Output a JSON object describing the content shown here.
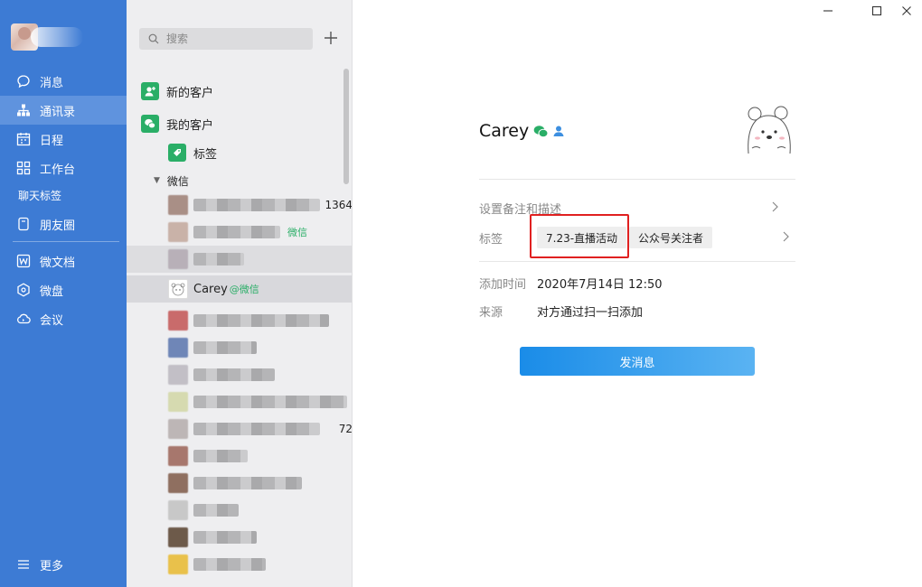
{
  "nav": {
    "items": [
      {
        "label": "消息",
        "icon": "chat-bubble-icon"
      },
      {
        "label": "通讯录",
        "icon": "org-chart-icon"
      },
      {
        "label": "日程",
        "icon": "calendar-icon"
      },
      {
        "label": "工作台",
        "icon": "grid-icon"
      },
      {
        "label": "聊天标签",
        "icon": ""
      },
      {
        "label": "朋友圈",
        "icon": "moments-icon"
      },
      {
        "label": "微文档",
        "icon": "doc-icon"
      },
      {
        "label": "微盘",
        "icon": "disk-icon"
      },
      {
        "label": "会议",
        "icon": "cloud-meeting-icon"
      },
      {
        "label": "更多",
        "icon": "menu-icon"
      }
    ],
    "active": "通讯录",
    "accent": "#3d7bd4"
  },
  "contacts_panel": {
    "search_placeholder": "搜索",
    "new_customers": "新的客户",
    "my_customers": "我的客户",
    "tags": "标签",
    "wechat_group": "微信",
    "partial_texts": {
      "row1_tail": "1364",
      "row9_tail": "72",
      "source_suffix": "微信"
    },
    "selected_contact": {
      "name": "Carey",
      "source": "@微信"
    }
  },
  "detail": {
    "name": "Carey",
    "remark_label": "设置备注和描述",
    "tags_label": "标签",
    "tags": [
      "7.23-直播活动",
      "公众号关注者"
    ],
    "added_time_label": "添加时间",
    "added_time": "2020年7月14日 12:50",
    "source_label": "来源",
    "source": "对方通过扫一扫添加",
    "send_button": "发消息"
  },
  "colors": {
    "wechat_green": "#2aae67",
    "highlight_red": "#e02020",
    "button_blue": "#1a8ce8"
  }
}
